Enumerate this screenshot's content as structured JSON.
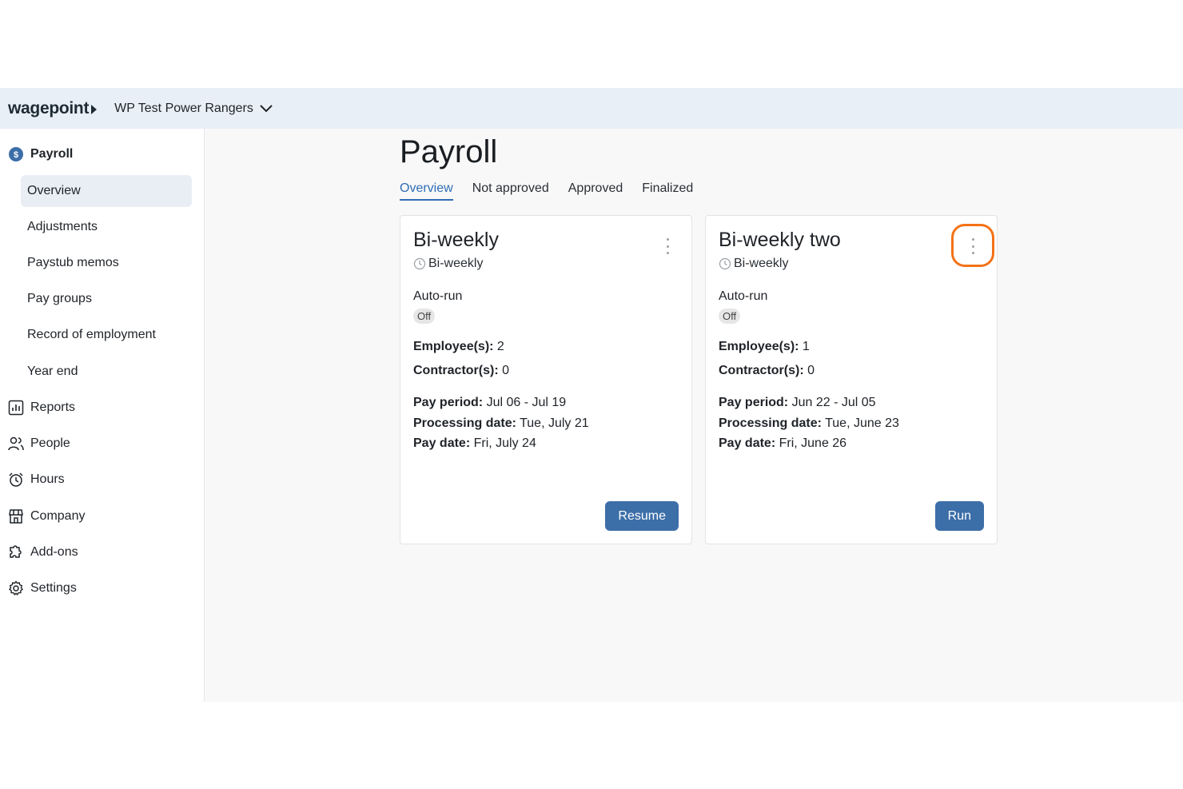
{
  "header": {
    "logo": "wagepoint",
    "company": "WP Test Power Rangers"
  },
  "sidebar": {
    "payroll": "Payroll",
    "sub_items": [
      {
        "label": "Overview",
        "active": true
      },
      {
        "label": "Adjustments"
      },
      {
        "label": "Paystub memos"
      },
      {
        "label": "Pay groups"
      },
      {
        "label": "Record of employment"
      },
      {
        "label": "Year end"
      }
    ],
    "items": [
      {
        "label": "Reports",
        "icon": "bar-chart-icon"
      },
      {
        "label": "People",
        "icon": "people-icon"
      },
      {
        "label": "Hours",
        "icon": "alarm-clock-icon"
      },
      {
        "label": "Company",
        "icon": "store-icon"
      },
      {
        "label": "Add-ons",
        "icon": "puzzle-icon"
      },
      {
        "label": "Settings",
        "icon": "gear-icon"
      }
    ]
  },
  "main": {
    "title": "Payroll",
    "tabs": [
      {
        "label": "Overview",
        "active": true
      },
      {
        "label": "Not approved"
      },
      {
        "label": "Approved"
      },
      {
        "label": "Finalized"
      }
    ]
  },
  "cards": [
    {
      "title": "Bi-weekly",
      "frequency": "Bi-weekly",
      "autorun_label": "Auto-run",
      "autorun_value": "Off",
      "employees_label": "Employee(s):",
      "employees": "2",
      "contractors_label": "Contractor(s):",
      "contractors": "0",
      "pay_period_label": "Pay period:",
      "pay_period": "Jul 06 - Jul 19",
      "processing_label": "Processing date:",
      "processing_date": "Tue, July 21",
      "pay_date_label": "Pay date:",
      "pay_date": "Fri, July 24",
      "button": "Resume"
    },
    {
      "title": "Bi-weekly two",
      "frequency": "Bi-weekly",
      "autorun_label": "Auto-run",
      "autorun_value": "Off",
      "employees_label": "Employee(s):",
      "employees": "1",
      "contractors_label": "Contractor(s):",
      "contractors": "0",
      "pay_period_label": "Pay period:",
      "pay_period": "Jun 22 - Jul 05",
      "processing_label": "Processing date:",
      "processing_date": "Tue, June 23",
      "pay_date_label": "Pay date:",
      "pay_date": "Fri, June 26",
      "button": "Run"
    }
  ],
  "colors": {
    "accent": "#2f6db5",
    "button": "#3c6ea8",
    "highlight_ring": "#f47216",
    "topbar": "#e9eff6"
  }
}
